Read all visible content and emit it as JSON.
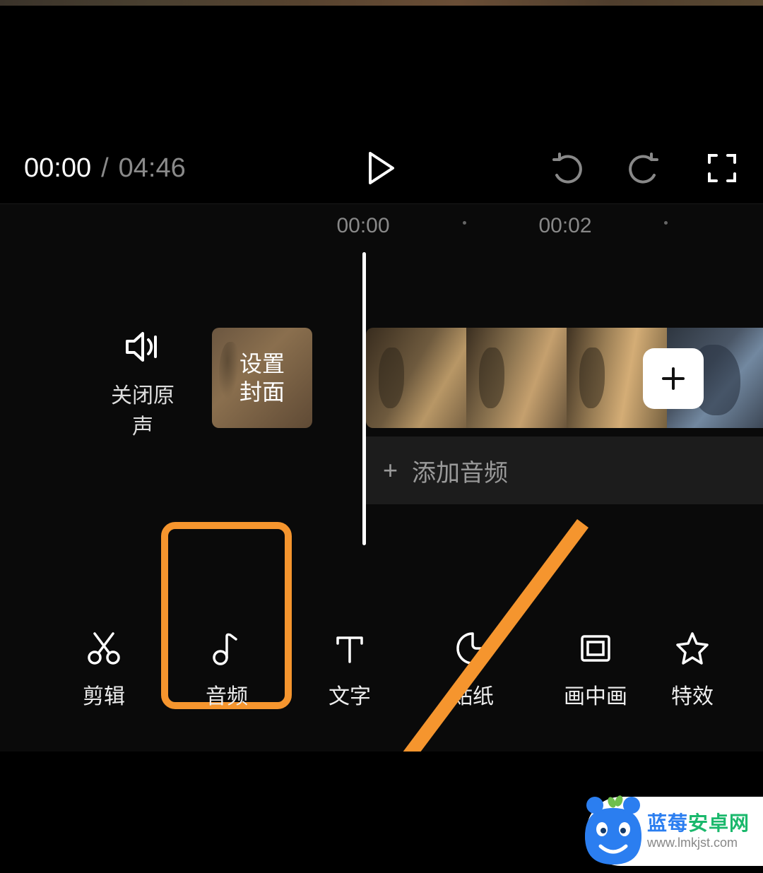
{
  "player": {
    "current_time": "00:00",
    "separator": "/",
    "total_time": "04:46"
  },
  "timeline": {
    "ruler": {
      "t0": "00:00",
      "t1": "00:02"
    },
    "mute_label": "关闭原声",
    "cover_label": "设置\n封面",
    "add_audio_label": "添加音频"
  },
  "toolbar": [
    {
      "id": "edit",
      "label": "剪辑"
    },
    {
      "id": "audio",
      "label": "音频"
    },
    {
      "id": "text",
      "label": "文字"
    },
    {
      "id": "sticker",
      "label": "贴纸"
    },
    {
      "id": "pip",
      "label": "画中画"
    },
    {
      "id": "effects",
      "label": "特效"
    }
  ],
  "watermark": {
    "brand_a": "蓝莓",
    "brand_b": "安卓网",
    "url": "www.lmkjst.com"
  }
}
